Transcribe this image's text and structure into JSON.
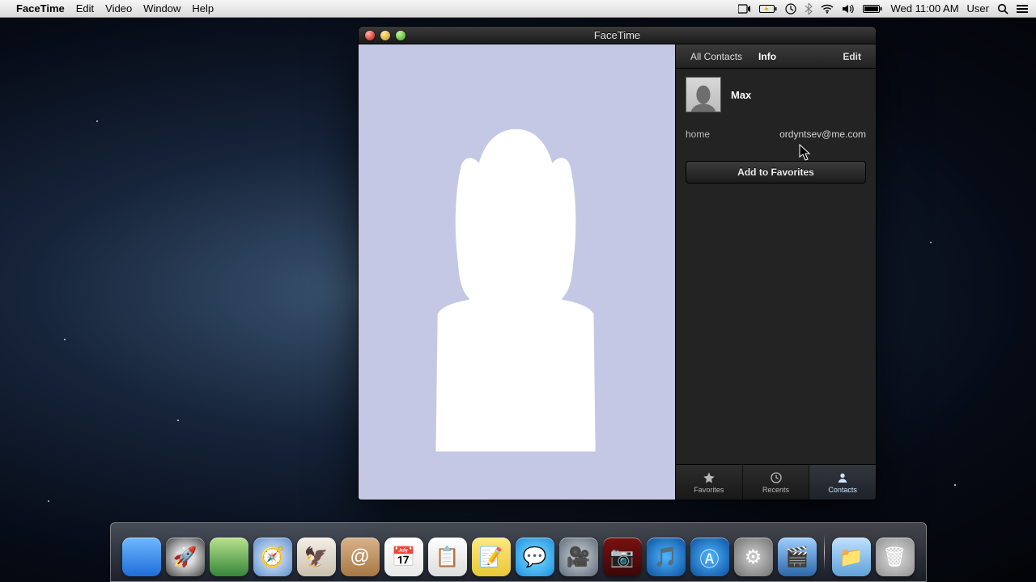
{
  "menubar": {
    "app_name": "FaceTime",
    "items": [
      "Edit",
      "Video",
      "Window",
      "Help"
    ],
    "clock": "Wed 11:00 AM",
    "user": "User"
  },
  "window": {
    "title": "FaceTime"
  },
  "sidebar": {
    "tab_all": "All Contacts",
    "tab_info": "Info",
    "edit": "Edit",
    "contact_name": "Max",
    "email_label": "home",
    "email_value": "ordyntsev@me.com",
    "add_favorites": "Add to Favorites",
    "bottom": {
      "favorites": "Favorites",
      "recents": "Recents",
      "contacts": "Contacts"
    }
  },
  "dock": {
    "items": [
      {
        "name": "finder",
        "bg": "linear-gradient(#6fb8ff,#1e6ed8)",
        "glyph": ""
      },
      {
        "name": "launchpad",
        "bg": "radial-gradient(circle,#ddd 30%,#555 90%)",
        "glyph": "🚀"
      },
      {
        "name": "mission-ctrl",
        "bg": "linear-gradient(#b8e28e,#35853a)",
        "glyph": ""
      },
      {
        "name": "safari",
        "bg": "radial-gradient(circle,#eaf3ff,#5d8ecb)",
        "glyph": "🧭"
      },
      {
        "name": "mail",
        "bg": "linear-gradient(#f4efe5,#cac0ad)",
        "glyph": "🦅"
      },
      {
        "name": "contacts",
        "bg": "linear-gradient(#d9b28a,#a77843)",
        "glyph": "@"
      },
      {
        "name": "calendar",
        "bg": "linear-gradient(#fff,#e8e8e8)",
        "glyph": "📅"
      },
      {
        "name": "reminders",
        "bg": "linear-gradient(#fff,#ddd)",
        "glyph": "📋"
      },
      {
        "name": "notes",
        "bg": "linear-gradient(#ffe97f,#e8c738)",
        "glyph": "📝"
      },
      {
        "name": "messages",
        "bg": "radial-gradient(circle,#7be0ff,#1d8de0)",
        "glyph": "💬"
      },
      {
        "name": "facetime",
        "bg": "radial-gradient(circle,#cfd6de,#5d6976)",
        "glyph": "🎥"
      },
      {
        "name": "photobooth",
        "bg": "linear-gradient(#7a1111,#3a0707)",
        "glyph": "📷"
      },
      {
        "name": "itunes",
        "bg": "radial-gradient(circle,#4fb6ff,#0b4f9e)",
        "glyph": "🎵"
      },
      {
        "name": "appstore",
        "bg": "radial-gradient(circle,#4fb6ff,#0b4f9e)",
        "glyph": "Ⓐ"
      },
      {
        "name": "preferences",
        "bg": "radial-gradient(circle,#cfcfcf,#6f6f6f)",
        "glyph": "⚙"
      },
      {
        "name": "screenflow",
        "bg": "linear-gradient(#9ecfff,#2d66a8)",
        "glyph": "🎬"
      }
    ],
    "right": [
      {
        "name": "downloads",
        "bg": "linear-gradient(#bfe0ff,#5fa2d8)",
        "glyph": "📁"
      },
      {
        "name": "trash",
        "bg": "radial-gradient(circle,#dedede,#8f8f8f)",
        "glyph": "🗑"
      }
    ]
  }
}
